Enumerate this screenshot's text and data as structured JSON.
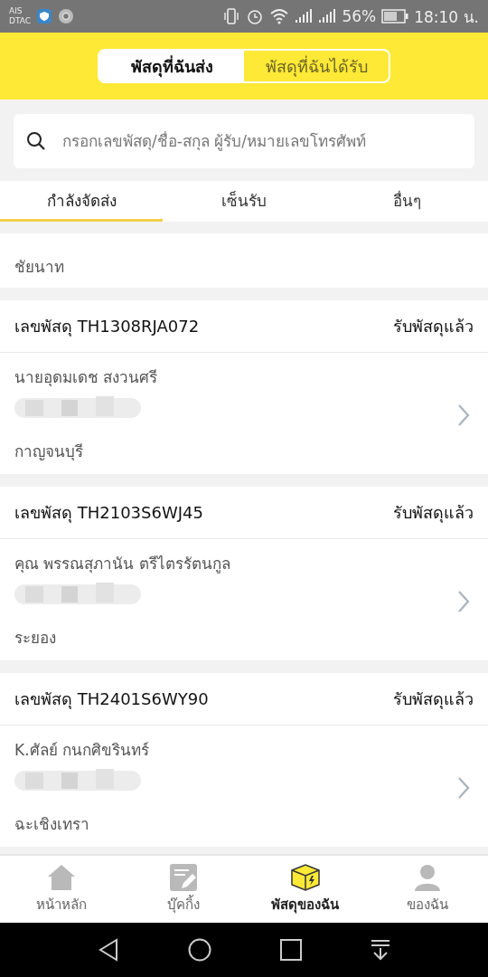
{
  "status_bar": {
    "carriers": [
      "AIS",
      "DTAC"
    ],
    "battery": "56%",
    "time": "18:10 น."
  },
  "segment": [
    {
      "label": "พัสดุที่ฉันส่ง",
      "selected": true
    },
    {
      "label": "พัสดุที่ฉันได้รับ",
      "selected": false
    }
  ],
  "search": {
    "placeholder": "กรอกเลขพัสดุ/ชื่อ-สกุล ผู้รับ/หมายเลขโทรศัพท์"
  },
  "tabs": [
    {
      "label": "กำลังจัดส่ง",
      "selected": true
    },
    {
      "label": "เซ็นรับ",
      "selected": false
    },
    {
      "label": "อื่นๆ",
      "selected": false
    }
  ],
  "parcels": [
    {
      "kind": "partial",
      "province": "ชัยนาท"
    },
    {
      "kind": "full",
      "tracking": "เลขพัสดุ TH1308RJA072",
      "status": "รับพัสดุแล้ว",
      "recipient": "นายอุดมเดช สงวนศรี",
      "province": "กาญจนบุรี"
    },
    {
      "kind": "full",
      "tracking": "เลขพัสดุ TH2103S6WJ45",
      "status": "รับพัสดุแล้ว",
      "recipient": "คุณ พรรณสุภานัน ตรีไตรรัตนกูล",
      "province": "ระยอง"
    },
    {
      "kind": "full",
      "tracking": "เลขพัสดุ TH2401S6WY90",
      "status": "รับพัสดุแล้ว",
      "recipient": "K.ศัลย์ กนกศิขรินทร์",
      "province": "ฉะเชิงเทรา"
    }
  ],
  "bottom_nav": [
    {
      "kind": "home",
      "label": "หน้าหลัก",
      "selected": false
    },
    {
      "kind": "booking",
      "label": "บุ๊คกิ้ง",
      "selected": false
    },
    {
      "kind": "box",
      "label": "พัสดุของฉัน",
      "selected": true
    },
    {
      "kind": "person",
      "label": "ของฉัน",
      "selected": false
    }
  ]
}
